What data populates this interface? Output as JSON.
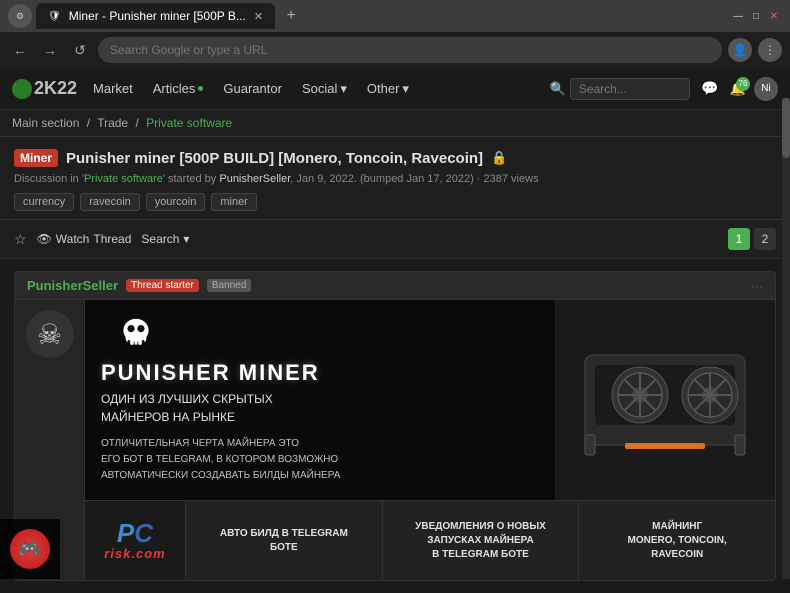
{
  "browser": {
    "title": "Miner - Punisher miner [500P B...",
    "url": "Search Google or type a URL",
    "tab_label": "Miner - Punisher miner [500P B...",
    "new_tab": "+",
    "nav_back": "←",
    "nav_forward": "→",
    "nav_refresh": "↺",
    "minimize": "—",
    "maximize": "□",
    "close": "✕"
  },
  "site": {
    "logo": "2K22",
    "nav_items": [
      {
        "label": "Market",
        "dot": false
      },
      {
        "label": "Articles",
        "dot": true
      },
      {
        "label": "Guarantor",
        "dot": false
      },
      {
        "label": "Social",
        "dot": false,
        "dropdown": true
      },
      {
        "label": "Other",
        "dot": false,
        "dropdown": true
      }
    ],
    "search_placeholder": "Search...",
    "icons": {
      "chat": "💬",
      "bell": "🔔",
      "bell_count": "76",
      "avatar": "Ni"
    }
  },
  "breadcrumb": {
    "items": [
      "Main section",
      "Trade",
      "Private software"
    ],
    "active_index": 2
  },
  "thread": {
    "tag": "Miner",
    "title": "Punisher miner [500P BUILD] [Monero, Toncoin, Ravecoin]",
    "lock_icon": "🔒",
    "meta": "Discussion in 'Private software' started by PunisherSeller, Jan 9, 2022. (bumped Jan 17, 2022) · 2387 views",
    "tags": [
      "currency",
      "ravecoin",
      "yourcoin",
      "miner"
    ],
    "watch_label": "Watch",
    "thread_label": "Thread",
    "search_label": "Search",
    "search_chevron": "▾",
    "page1": "1",
    "page2": "2"
  },
  "post": {
    "username": "PunisherSeller",
    "role": "Thread starter",
    "status": "Banned",
    "more_icon": "···",
    "avatar_icon": "☠",
    "banner": {
      "title": "PUNISHER MINER",
      "subtitle": "ОДИН ИЗ ЛУЧШИХ СКРЫТЫХ\nМАЙНЕРОВ НА РЫНКЕ",
      "desc": "ОТЛИЧИТЕЛЬНАЯ ЧЕРТА МАЙНЕРА ЭТО\nЕГО БОТ В TELEGRAM, В КОТОРОМ ВОЗМОЖНО\nАВТОМАТИЧЕСКИ СОЗДАВАТЬ БИЛДЫ МАЙНЕРА"
    },
    "features": [
      "АВТО БИЛД В TELEGRAM\nБОТЕ",
      "УВЕДОМЛЕНИЯ О НОВЫХ\nЗАПУСКАХ МАЙНЕРА\nВ TELEGRAM БОТЕ",
      "МАЙНИНГ\nMONERO, TONCOIN,\nRAVECOIN"
    ]
  },
  "bottom_widget": {
    "icon": "🎮"
  }
}
